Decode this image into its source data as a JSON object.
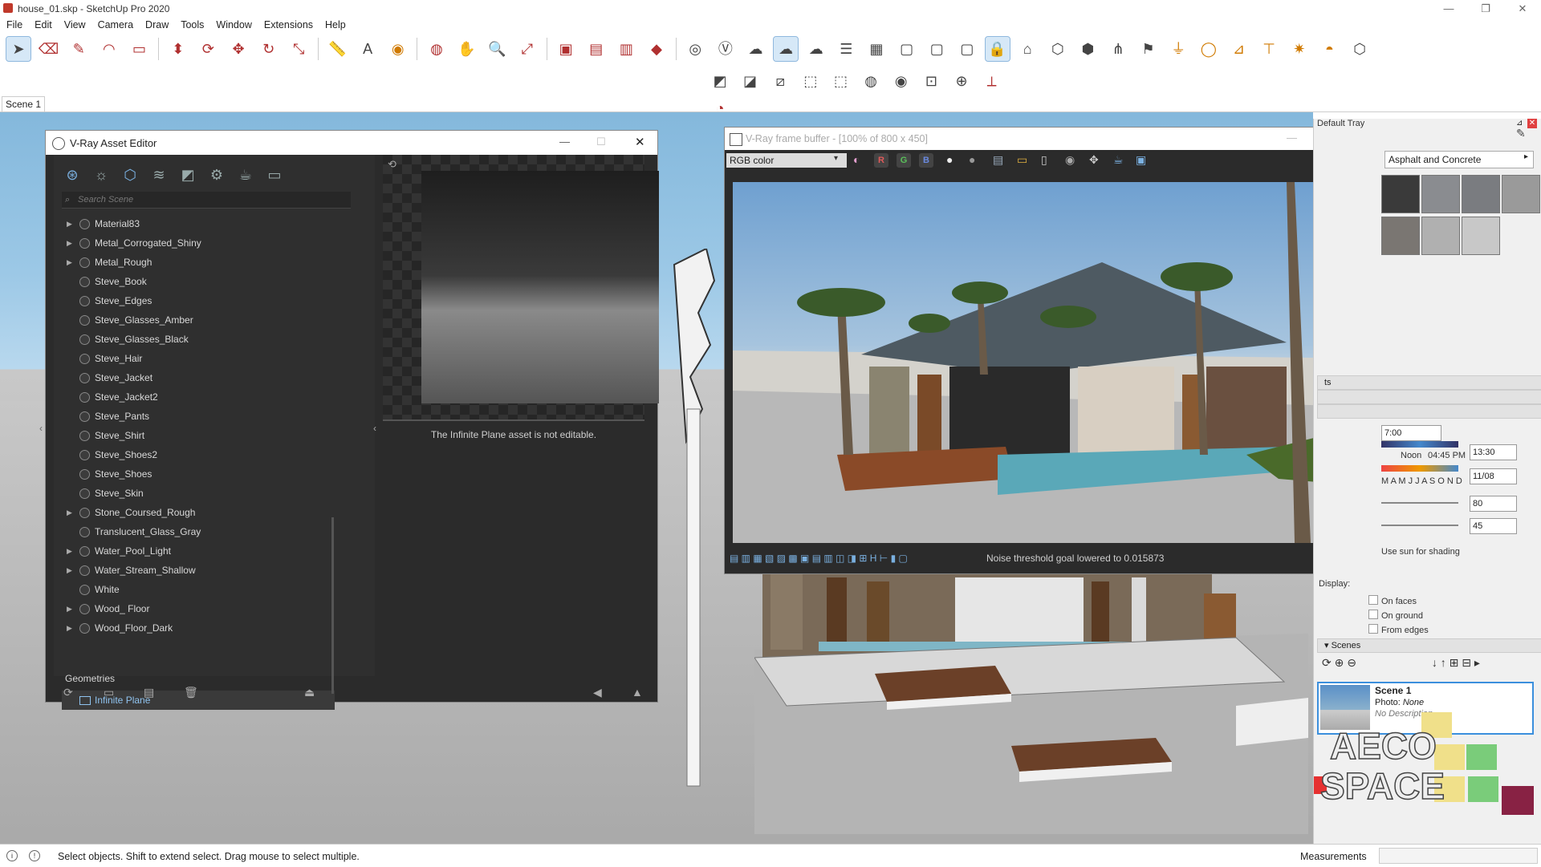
{
  "window": {
    "title": "house_01.skp - SketchUp Pro 2020",
    "controls": {
      "minimize": "—",
      "restore": "❐",
      "close": "✕"
    }
  },
  "menu": [
    "File",
    "Edit",
    "View",
    "Camera",
    "Draw",
    "Tools",
    "Window",
    "Extensions",
    "Help"
  ],
  "scene_tab": "Scene 1",
  "asset_editor": {
    "title": "V-Ray Asset Editor",
    "search_placeholder": "Search Scene",
    "materials": [
      {
        "name": "Material83",
        "expandable": true
      },
      {
        "name": "Metal_Corrogated_Shiny",
        "expandable": true
      },
      {
        "name": "Metal_Rough",
        "expandable": true
      },
      {
        "name": "Steve_Book",
        "expandable": false
      },
      {
        "name": "Steve_Edges",
        "expandable": false
      },
      {
        "name": "Steve_Glasses_Amber",
        "expandable": false
      },
      {
        "name": "Steve_Glasses_Black",
        "expandable": false
      },
      {
        "name": "Steve_Hair",
        "expandable": false
      },
      {
        "name": "Steve_Jacket",
        "expandable": false
      },
      {
        "name": "Steve_Jacket2",
        "expandable": false
      },
      {
        "name": "Steve_Pants",
        "expandable": false
      },
      {
        "name": "Steve_Shirt",
        "expandable": false
      },
      {
        "name": "Steve_Shoes2",
        "expandable": false
      },
      {
        "name": "Steve_Shoes",
        "expandable": false
      },
      {
        "name": "Steve_Skin",
        "expandable": false
      },
      {
        "name": "Stone_Coursed_Rough",
        "expandable": true
      },
      {
        "name": "Translucent_Glass_Gray",
        "expandable": false
      },
      {
        "name": "Water_Pool_Light",
        "expandable": true
      },
      {
        "name": "Water_Stream_Shallow",
        "expandable": true
      },
      {
        "name": "White",
        "expandable": false
      },
      {
        "name": "Wood_ Floor",
        "expandable": true
      },
      {
        "name": "Wood_Floor_Dark",
        "expandable": true
      }
    ],
    "geometries_header": "Geometries",
    "selected_geometry": "Infinite Plane",
    "note": "The Infinite Plane asset is not editable."
  },
  "frame_buffer": {
    "title": "V-Ray frame buffer - [100% of 800 x 450]",
    "channel": "RGB color",
    "channels": [
      "R",
      "G",
      "B"
    ],
    "status": "Noise threshold goal lowered to 0.015873"
  },
  "tray": {
    "title": "Default Tray",
    "material_library": "Asphalt and Concrete",
    "panel_partial": "ts",
    "time_start": "7:00",
    "noon": "Noon",
    "end_time": "04:45 PM",
    "months": "M A M J J A S O N D",
    "time_value": "13:30",
    "date_value": "11/08",
    "light_value": "80",
    "dark_value": "45",
    "use_sun": "Use sun for shading",
    "display_label": "Display:",
    "display_options": [
      "On faces",
      "On ground",
      "From edges"
    ],
    "scenes_header": "Scenes",
    "scene": {
      "name": "Scene 1",
      "photo": "Photo: ",
      "photo_value": "None",
      "description": "No Description"
    },
    "logo_text": "AECO SPACE"
  },
  "status": {
    "message": "Select objects. Shift to extend select. Drag mouse to select multiple.",
    "measurements_label": "Measurements"
  }
}
